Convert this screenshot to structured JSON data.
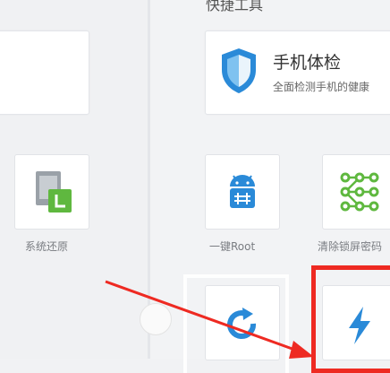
{
  "header": {
    "title": "快捷工具"
  },
  "cards": {
    "checkup": {
      "title": "手机体检",
      "subtitle": "全面检测手机的健康"
    }
  },
  "tools": [
    {
      "label": "系统还原",
      "icon": "system-restore-icon"
    },
    {
      "label": "一键Root",
      "icon": "android-root-icon"
    },
    {
      "label": "清除锁屏密码",
      "icon": "pattern-lock-icon"
    },
    {
      "label": "",
      "icon": "refresh-icon"
    },
    {
      "label": "",
      "icon": "lightning-icon"
    }
  ],
  "colors": {
    "accent": "#2a8ad8",
    "green": "#5fb83f",
    "highlight": "#ee2a22"
  }
}
